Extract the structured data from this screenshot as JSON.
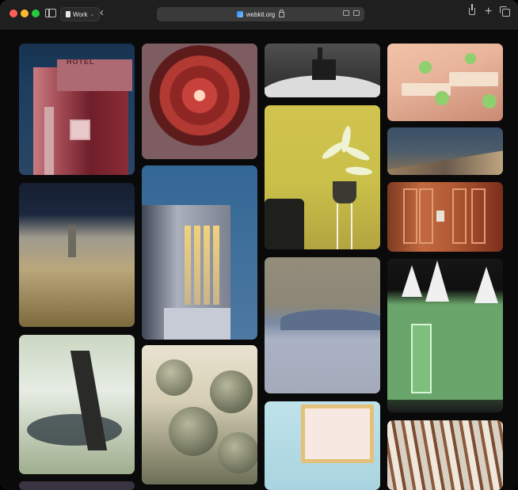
{
  "browser": {
    "profile_label": "Work",
    "address": "webkit.org"
  },
  "accent": {
    "close": "#ff5f57",
    "minimize": "#febc2e",
    "zoom": "#28c840"
  },
  "icons": [
    "sidebar-icon",
    "profile-icon",
    "chevron-down-icon",
    "back-icon",
    "site-icon",
    "lock-icon",
    "translate-icon",
    "reader-icon",
    "share-icon",
    "plus-icon",
    "tabs-icon"
  ],
  "gallery": {
    "photos": [
      {
        "name": "hotel"
      },
      {
        "name": "flower"
      },
      {
        "name": "church"
      },
      {
        "name": "cafe"
      },
      {
        "name": "tower"
      },
      {
        "name": "plant"
      },
      {
        "name": "dock"
      },
      {
        "name": "hill"
      },
      {
        "name": "door"
      },
      {
        "name": "house"
      },
      {
        "name": "waves"
      },
      {
        "name": "forest"
      },
      {
        "name": "succulents"
      },
      {
        "name": "frame"
      },
      {
        "name": "bark"
      }
    ]
  }
}
